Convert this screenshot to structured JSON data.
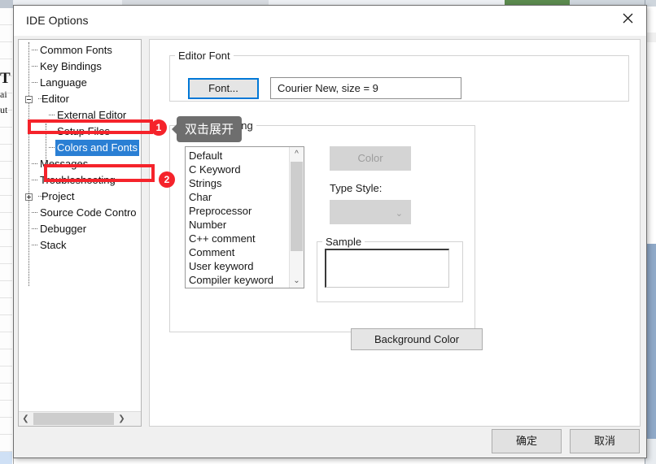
{
  "window": {
    "title": "IDE Options",
    "close_icon": "close-icon"
  },
  "tree": {
    "items": [
      {
        "label": "Common Fonts",
        "level": 1,
        "toggle": "none",
        "selected": false
      },
      {
        "label": "Key Bindings",
        "level": 1,
        "toggle": "none",
        "selected": false
      },
      {
        "label": "Language",
        "level": 1,
        "toggle": "none",
        "selected": false
      },
      {
        "label": "Editor",
        "level": 0,
        "toggle": "minus",
        "selected": false
      },
      {
        "label": "External Editor",
        "level": 2,
        "toggle": "none",
        "selected": false
      },
      {
        "label": "Setup Files",
        "level": 2,
        "toggle": "none",
        "selected": false
      },
      {
        "label": "Colors and Fonts",
        "level": 2,
        "toggle": "none",
        "selected": true
      },
      {
        "label": "Messages",
        "level": 1,
        "toggle": "none",
        "selected": false
      },
      {
        "label": "Troubleshooting",
        "level": 1,
        "toggle": "none",
        "selected": false
      },
      {
        "label": "Project",
        "level": 0,
        "toggle": "plus",
        "selected": false
      },
      {
        "label": "Source Code Contro",
        "level": 1,
        "toggle": "none",
        "selected": false
      },
      {
        "label": "Debugger",
        "level": 1,
        "toggle": "none",
        "selected": false
      },
      {
        "label": "Stack",
        "level": 1,
        "toggle": "none",
        "selected": false
      }
    ],
    "hscroll": {
      "left_arrow": "chevron-left-icon",
      "right_arrow": "chevron-right-icon"
    }
  },
  "editor_font": {
    "legend": "Editor Font",
    "font_button": "Font...",
    "font_value": "Courier New, size = 9"
  },
  "syntax_coloring": {
    "legend": "Syntax Coloring",
    "list_items": [
      "Default",
      "C Keyword",
      "Strings",
      "Char",
      "Preprocessor",
      "Number",
      "C++ comment",
      "Comment",
      "User keyword",
      "Compiler keyword"
    ],
    "scroll_up_icon": "chevron-up-icon",
    "scroll_down_icon": "chevron-down-icon",
    "color_button": "Color",
    "type_style_label": "Type Style:",
    "type_style_value": "",
    "type_style_chevron": "chevron-down-icon",
    "sample_legend": "Sample",
    "sample_value": "",
    "background_color_button": "Background Color"
  },
  "footer": {
    "ok_label": "确定",
    "cancel_label": "取消"
  },
  "annotations": {
    "tooltip_text": "双击展开",
    "badge_1": "1",
    "badge_2": "2",
    "accent_color": "#f5232b",
    "tooltip_bg": "#6e6e6e"
  },
  "background": {
    "fragment_1": "T",
    "fragment_2": "ai",
    "fragment_3": "ut"
  }
}
